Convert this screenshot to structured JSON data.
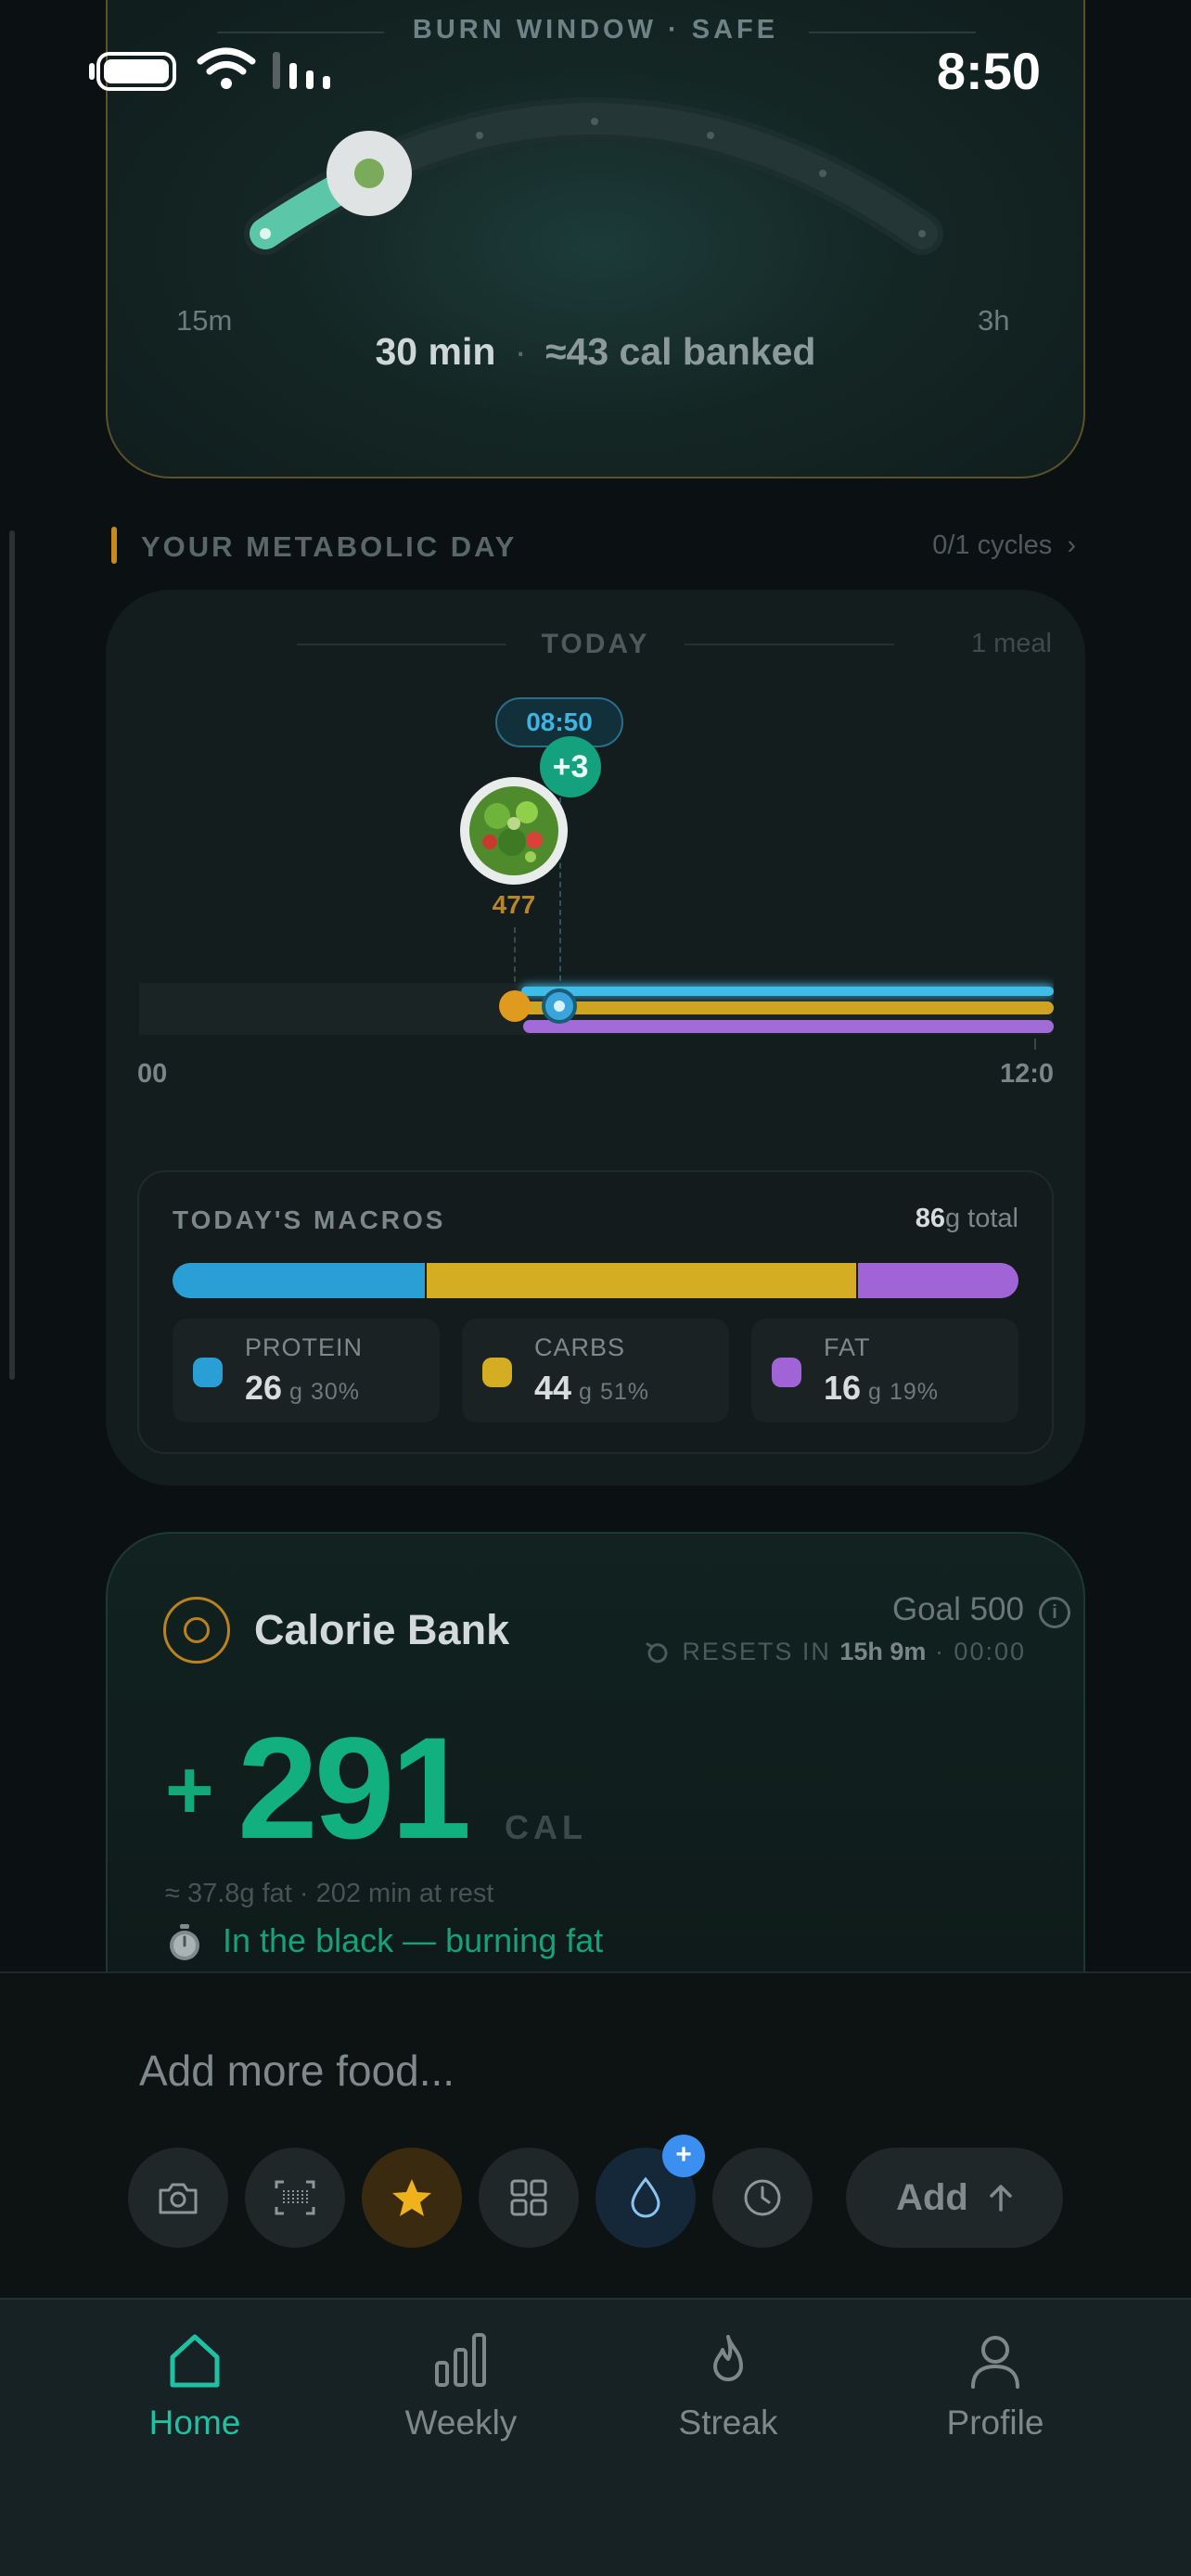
{
  "status_bar": {
    "time": "8:50"
  },
  "burn_window": {
    "title": "BURN WINDOW · SAFE",
    "min_label": "15m",
    "max_label": "3h",
    "duration": "30 min",
    "banked": "≈43 cal banked",
    "slider_fraction": 0.13
  },
  "metabolic_day": {
    "section_title": "YOUR METABOLIC DAY",
    "cycles": "0/1 cycles",
    "day_label": "TODAY",
    "meal_count": "1 meal",
    "meal": {
      "time": "08:50",
      "extra": "+3",
      "calories": "477"
    },
    "timeline_start": "00",
    "timeline_end": "12:0"
  },
  "macros": {
    "title": "TODAY'S MACROS",
    "total_value": "86",
    "total_suffix": "g total",
    "items": [
      {
        "name": "PROTEIN",
        "value": "26",
        "unit": "g",
        "percent": "30%",
        "share": 30,
        "color": "#2a9fd6"
      },
      {
        "name": "CARBS",
        "value": "44",
        "unit": "g",
        "percent": "51%",
        "share": 51,
        "color": "#d4ad23"
      },
      {
        "name": "FAT",
        "value": "16",
        "unit": "g",
        "percent": "19%",
        "share": 19,
        "color": "#a064d6"
      }
    ]
  },
  "calorie_bank": {
    "title": "Calorie Bank",
    "goal": "Goal 500",
    "resets_label": "RESETS IN",
    "resets_time": "15h 9m",
    "resets_at": "· 00:00",
    "sign": "+",
    "value": "291",
    "unit": "CAL",
    "subtext": "≈ 37.8g fat · 202 min at rest",
    "status": "In the black — burning fat"
  },
  "input": {
    "placeholder": "Add more food...",
    "add_label": "Add",
    "water_badge": "+",
    "tools": [
      "camera-icon",
      "barcode-scan-icon",
      "star-icon",
      "grid-icon",
      "water-drop-icon",
      "clock-icon"
    ]
  },
  "tabs": [
    {
      "label": "Home",
      "icon": "home-icon",
      "active": true
    },
    {
      "label": "Weekly",
      "icon": "bar-chart-icon",
      "active": false
    },
    {
      "label": "Streak",
      "icon": "flame-icon",
      "active": false
    },
    {
      "label": "Profile",
      "icon": "person-icon",
      "active": false
    }
  ],
  "colors": {
    "accent_green": "#12b07e",
    "accent_teal": "#1fc1a4",
    "protein": "#2a9fd6",
    "carbs": "#d4ad23",
    "fat": "#a064d6",
    "bank_ring": "#b9821f"
  }
}
